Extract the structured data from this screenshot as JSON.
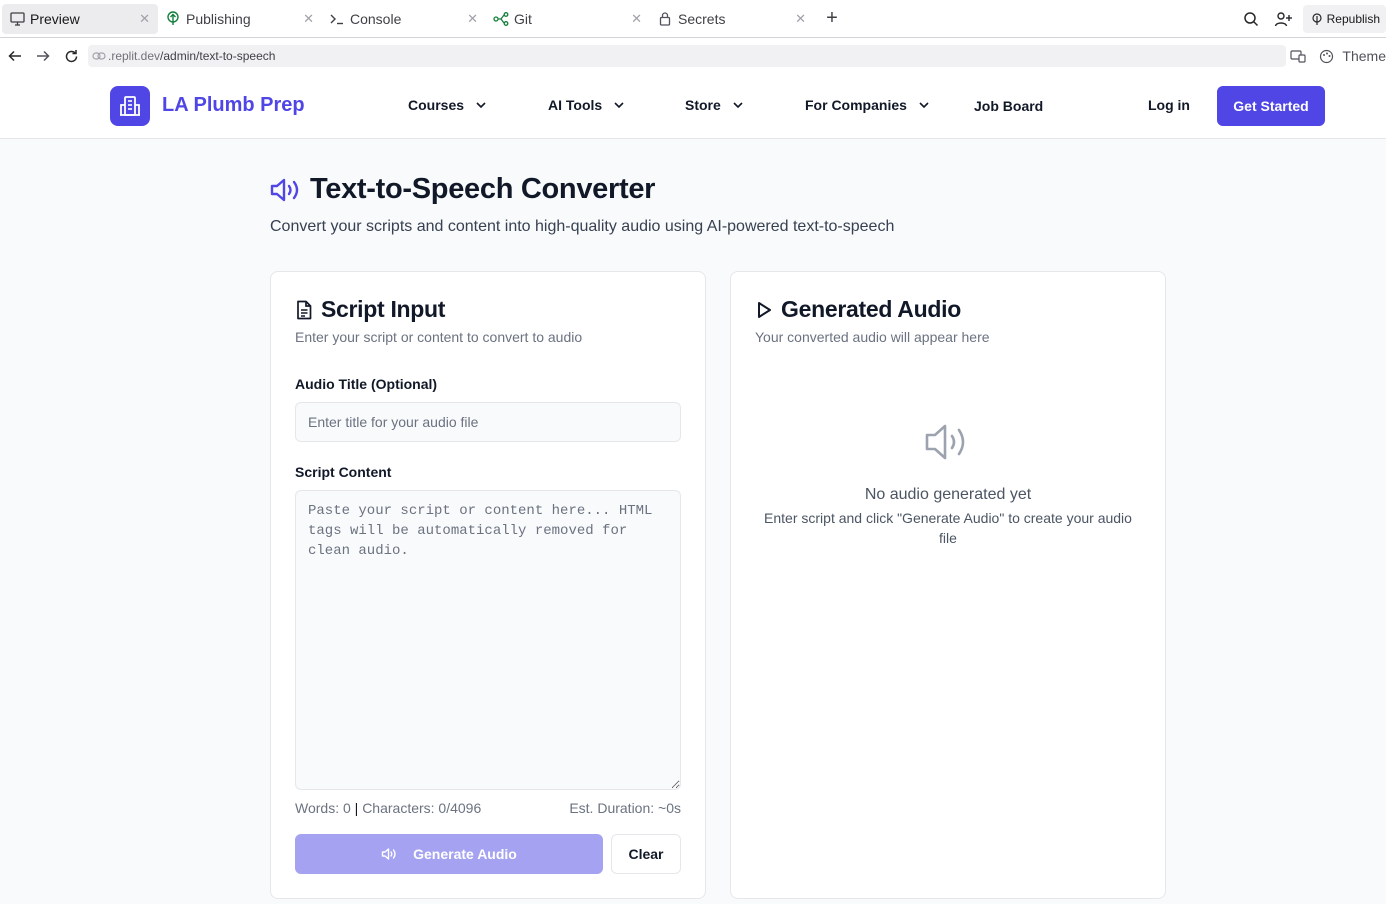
{
  "ide": {
    "tabs": [
      {
        "label": "Preview",
        "icon": "monitor-icon",
        "active": true
      },
      {
        "label": "Publishing",
        "icon": "publish-icon"
      },
      {
        "label": "Console",
        "icon": "terminal-icon"
      },
      {
        "label": "Git",
        "icon": "git-icon"
      },
      {
        "label": "Secrets",
        "icon": "lock-icon"
      }
    ],
    "republish_label": "Republish",
    "url_prefix": ".replit.dev",
    "url_path": "/admin/text-to-speech",
    "theme_label": "Theme"
  },
  "site": {
    "brand": "LA Plumb Prep",
    "nav": [
      "Courses",
      "AI Tools",
      "Store",
      "For Companies",
      "Job Board"
    ],
    "login": "Log in",
    "cta": "Get Started",
    "accent_color": "#4f46e5"
  },
  "page": {
    "title": "Text-to-Speech Converter",
    "subtitle": "Convert your scripts and content into high-quality audio using AI-powered text-to-speech"
  },
  "input_card": {
    "title": "Script Input",
    "description": "Enter your script or content to convert to audio",
    "audio_title_label": "Audio Title (Optional)",
    "audio_title_placeholder": "Enter title for your audio file",
    "audio_title_value": "",
    "script_label": "Script Content",
    "script_placeholder": "Paste your script or content here... HTML tags will be automatically removed for clean audio.",
    "script_value": "",
    "stats_words": "Words: 0",
    "stats_chars": "Characters: 0/4096",
    "stats_duration": "Est. Duration: ~0s",
    "generate_label": "Generate Audio",
    "clear_label": "Clear"
  },
  "output_card": {
    "title": "Generated Audio",
    "description": "Your converted audio will appear here",
    "empty_title": "No audio generated yet",
    "empty_sub": "Enter script and click \"Generate Audio\" to create your audio file"
  }
}
